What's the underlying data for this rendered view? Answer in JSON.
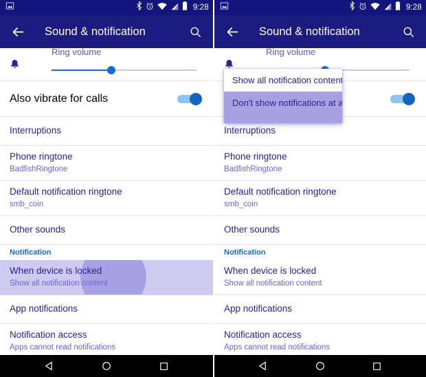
{
  "status_bar": {
    "time": "9:28",
    "icons": [
      "image-icon",
      "bluetooth-icon",
      "alarm-icon",
      "wifi-icon",
      "signal-icon",
      "battery-icon"
    ]
  },
  "app_bar": {
    "title": "Sound & notification",
    "back_icon": "back-arrow-icon",
    "search_icon": "search-icon"
  },
  "colors": {
    "status_bar_bg": "#14147d",
    "app_bar_bg": "#1b1b80",
    "accent_blue": "#0f6fd1",
    "section_header": "#1668dc",
    "primary_text": "#241f9c",
    "secondary_text": "#6a64d8",
    "highlight": "#cfcbf0",
    "ripple": "#a9a2e2"
  },
  "volume": {
    "label": "Ring volume",
    "icon": "bell-icon",
    "value_percent": 41
  },
  "rows": {
    "vibrate": {
      "label": "Also vibrate for calls",
      "toggle_on": true
    },
    "interruptions": {
      "label": "Interruptions"
    },
    "phone_ringtone": {
      "label": "Phone ringtone",
      "value": "BadfishRingtone"
    },
    "default_notification_ringtone": {
      "label": "Default notification ringtone",
      "value": "smb_coin"
    },
    "other_sounds": {
      "label": "Other sounds"
    },
    "notification_section": {
      "label": "Notification"
    },
    "when_device_locked": {
      "label": "When device is locked",
      "value": "Show all notification content"
    },
    "app_notifications": {
      "label": "App notifications"
    },
    "notification_access": {
      "label": "Notification access",
      "value": "Apps cannot read notifications"
    }
  },
  "popup": {
    "options": [
      {
        "label": "Show all notification content",
        "selected": false
      },
      {
        "label": "Don't show notifications at all",
        "selected": true
      }
    ]
  },
  "nav_bar": {
    "back": "nav-back-icon",
    "home": "nav-home-icon",
    "recents": "nav-recents-icon"
  }
}
